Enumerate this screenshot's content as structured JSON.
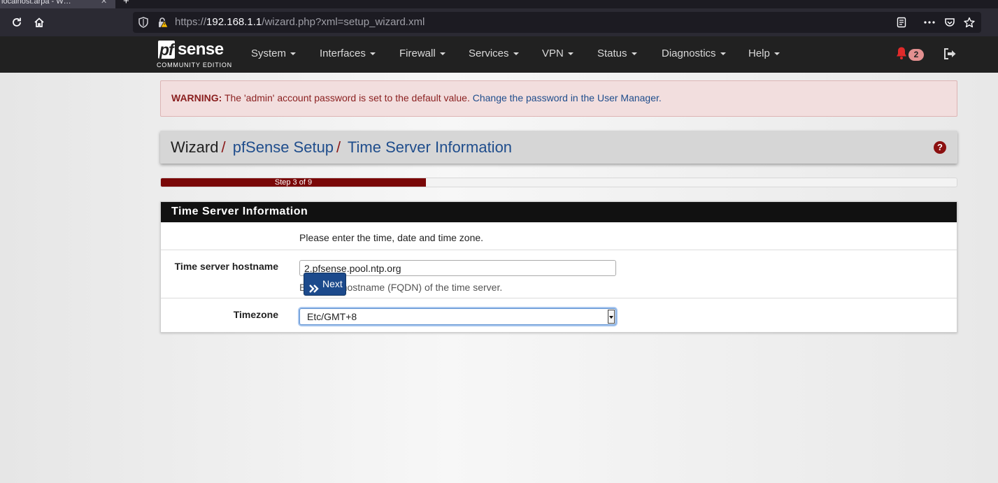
{
  "browser": {
    "tab_title": "localhost.arpa - W…",
    "tab_close": "✕",
    "new_tab": "+",
    "url_prefix": "https://",
    "url_host": "192.168.1.1",
    "url_path": "/wizard.php?xml=setup_wizard.xml"
  },
  "header": {
    "logo_pf": "pf",
    "logo_sense": "sense",
    "logo_edition": "COMMUNITY EDITION",
    "menu": [
      "System",
      "Interfaces",
      "Firewall",
      "Services",
      "VPN",
      "Status",
      "Diagnostics",
      "Help"
    ],
    "notification_count": "2"
  },
  "alert": {
    "label": "WARNING:",
    "text": " The 'admin' account password is set to the default value. ",
    "link": "Change the password in the User Manager."
  },
  "breadcrumb": {
    "root": "Wizard",
    "separator": "/",
    "item1": "pfSense Setup",
    "item2": "Time Server Information"
  },
  "progress": {
    "label": "Step 3 of 9",
    "fraction": 0.333
  },
  "panel": {
    "title": "Time Server Information",
    "intro": "Please enter the time, date and time zone.",
    "hostname_label": "Time server hostname",
    "hostname_value": "2.pfsense.pool.ntp.org",
    "hostname_help": "Enter the hostname (FQDN) of the time server.",
    "timezone_label": "Timezone",
    "timezone_value": "Etc/GMT+8"
  },
  "actions": {
    "next_label": "Next"
  },
  "colors": {
    "header_bg": "#212121",
    "accent_red": "#7a0808",
    "link_blue": "#1f4d8c",
    "button_blue": "#1c4a8c"
  }
}
